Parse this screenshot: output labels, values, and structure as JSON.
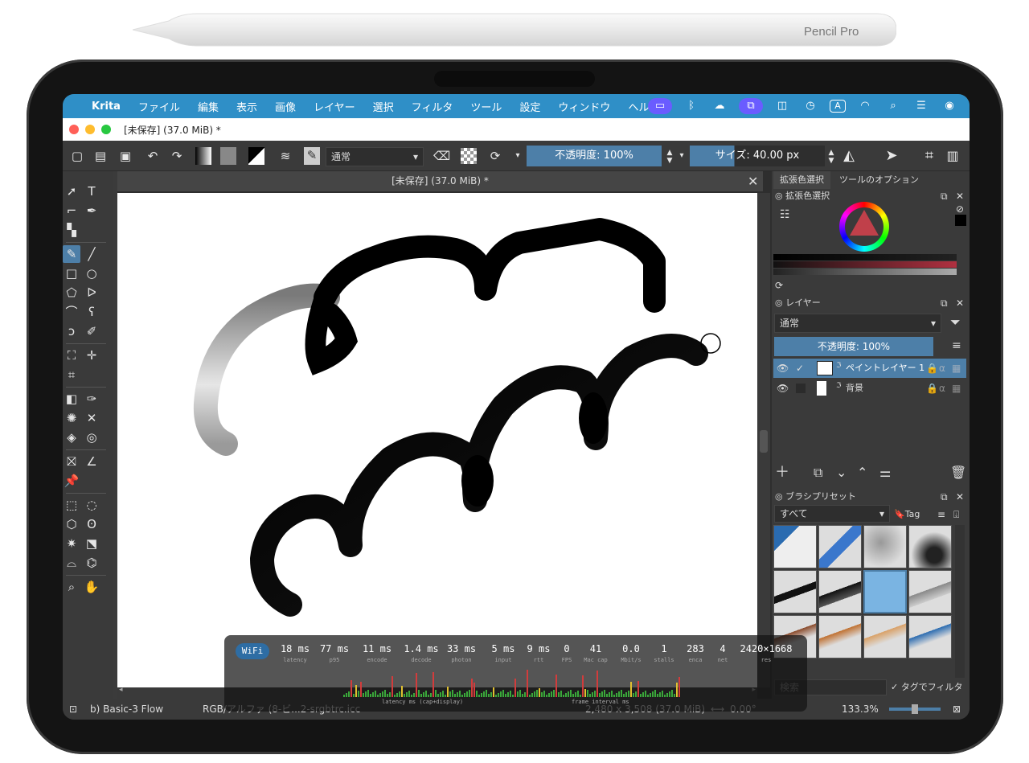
{
  "pencil": {
    "brand": "Pencil Pro"
  },
  "menubar": {
    "app": "Krita",
    "items": [
      "ファイル",
      "編集",
      "表示",
      "画像",
      "レイヤー",
      "選択",
      "フィルタ",
      "ツール",
      "設定",
      "ウィンドウ",
      "ヘルプ"
    ],
    "status_icons": [
      "screen-share-icon",
      "bluetooth-icon",
      "cloud-icon",
      "stage-manager-icon",
      "split-view-icon",
      "timer-icon",
      "input-source-icon",
      "wifi-icon",
      "search-icon",
      "control-center-icon",
      "siri-icon"
    ],
    "input_source": "A"
  },
  "titlebar": {
    "title": "[未保存]  (37.0 MiB) *"
  },
  "toolbar": {
    "blend_mode": "通常",
    "opacity": "不透明度: 100%",
    "size": "サイズ: 40.00 px"
  },
  "document": {
    "tab_title": "[未保存]  (37.0 MiB) *"
  },
  "dock": {
    "tabs": [
      "拡張色選択",
      "ツールのオプション"
    ],
    "color_panel_title": "拡張色選択",
    "layers_title": "レイヤー",
    "layers_blend": "通常",
    "layers_opacity": "不透明度: 100%",
    "layers": [
      {
        "name": "ペイントレイヤー 1"
      },
      {
        "name": "背景"
      }
    ],
    "brush_title": "ブラシプリセット",
    "brush_filter": "すべて",
    "brush_tag": "Tag",
    "search_placeholder": "検索",
    "filter_by_tag": "タグでフィルタ"
  },
  "status": {
    "brush": "b) Basic-3 Flow",
    "color_space": "RGB/アルファ (8-ビ...2-srgbtrc.icc",
    "image_size": "2,480 x 3,508 (37.0 MiB)",
    "rotation": "0.00°",
    "zoom": "133.3%"
  },
  "hud": {
    "wifi": "WiFi",
    "metrics": [
      {
        "v": "18 ms",
        "l": "latency"
      },
      {
        "v": "77 ms",
        "l": "p95"
      },
      {
        "v": "11 ms",
        "l": "encode"
      },
      {
        "v": "1.4 ms",
        "l": "decode"
      },
      {
        "v": "33 ms",
        "l": "photon"
      },
      {
        "v": "5 ms",
        "l": "input"
      },
      {
        "v": "9 ms",
        "l": "rtt"
      },
      {
        "v": "0",
        "l": "FPS"
      },
      {
        "v": "41",
        "l": "Mac cap"
      },
      {
        "v": "0.0",
        "l": "Mbit/s"
      },
      {
        "v": "1",
        "l": "stalls"
      },
      {
        "v": "283",
        "l": "enca"
      },
      {
        "v": "4",
        "l": "net"
      },
      {
        "v": "2420×1668",
        "l": "res"
      }
    ],
    "latency_caption": "latency ms (cap+display)",
    "frame_caption": "frame interval ms"
  },
  "colors": {
    "menubar": "#2f8fc7",
    "accent": "#4d7fa8",
    "panel": "#3a3a3a"
  }
}
